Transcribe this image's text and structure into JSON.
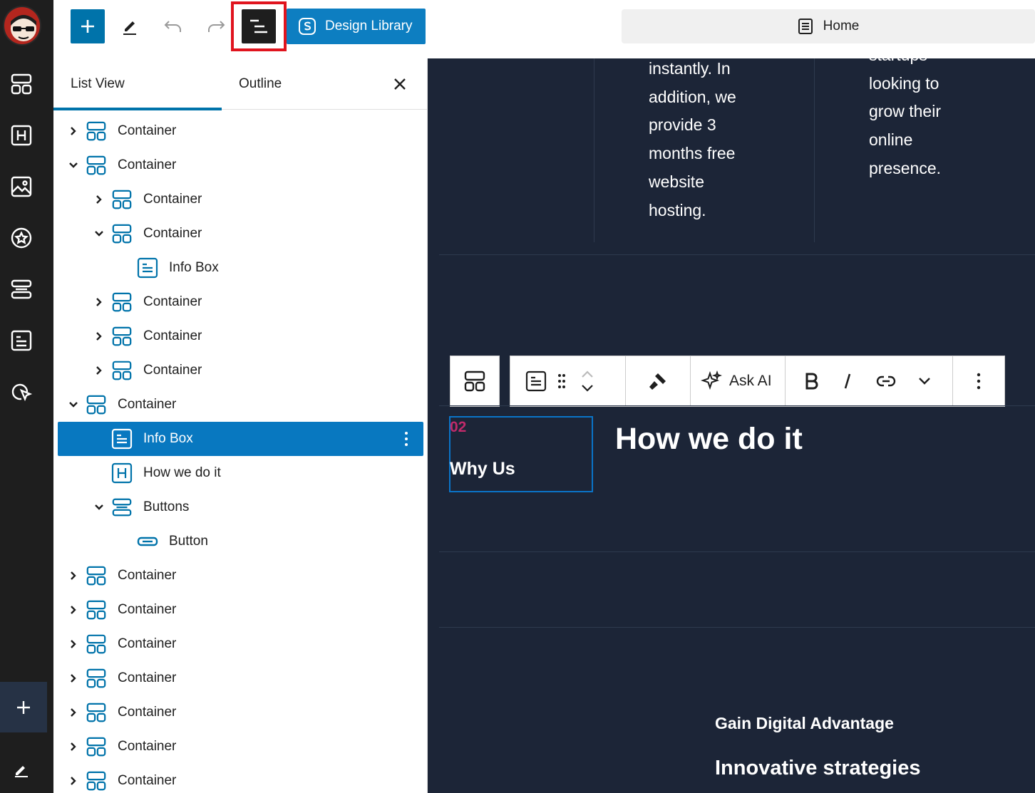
{
  "toolbar": {
    "design_library_label": "Design Library",
    "document_title": "Home"
  },
  "panel": {
    "tabs": [
      "List View",
      "Outline"
    ]
  },
  "tree": [
    {
      "label": "Container",
      "icon": "container-icon",
      "chevron": "right"
    },
    {
      "label": "Container",
      "icon": "container-icon",
      "chevron": "down"
    },
    {
      "label": "Container",
      "icon": "container-icon",
      "chevron": "right"
    },
    {
      "label": "Container",
      "icon": "container-icon",
      "chevron": "down"
    },
    {
      "label": "Info Box",
      "icon": "info-box-icon",
      "chevron": ""
    },
    {
      "label": "Container",
      "icon": "container-icon",
      "chevron": "right"
    },
    {
      "label": "Container",
      "icon": "container-icon",
      "chevron": "right"
    },
    {
      "label": "Container",
      "icon": "container-icon",
      "chevron": "right"
    },
    {
      "label": "Container",
      "icon": "container-icon",
      "chevron": "down"
    },
    {
      "label": "Info Box",
      "icon": "info-box-icon",
      "chevron": "",
      "selected": true
    },
    {
      "label": "How we do it",
      "icon": "heading-icon",
      "chevron": ""
    },
    {
      "label": "Buttons",
      "icon": "buttons-icon",
      "chevron": "down"
    },
    {
      "label": "Button",
      "icon": "button-icon",
      "chevron": ""
    },
    {
      "label": "Container",
      "icon": "container-icon",
      "chevron": "right"
    },
    {
      "label": "Container",
      "icon": "container-icon",
      "chevron": "right"
    },
    {
      "label": "Container",
      "icon": "container-icon",
      "chevron": "right"
    },
    {
      "label": "Container",
      "icon": "container-icon",
      "chevron": "right"
    },
    {
      "label": "Container",
      "icon": "container-icon",
      "chevron": "right"
    },
    {
      "label": "Container",
      "icon": "container-icon",
      "chevron": "right"
    },
    {
      "label": "Container",
      "icon": "container-icon",
      "chevron": "right"
    }
  ],
  "canvas": {
    "col1_lines": [
      "instantly. In",
      "addition, we",
      "provide 3",
      "months free",
      "website",
      "hosting."
    ],
    "col2_lines": [
      "startups",
      "looking to",
      "grow their",
      "online",
      "presence."
    ],
    "block_toolbar": {
      "ask_ai_label": "Ask AI"
    },
    "info_box_number": "02",
    "info_box_title": "Why Us",
    "heading": "How we do it",
    "gain_text": "Gain Digital Advantage",
    "innovative_text": "Innovative strategies"
  },
  "colors": {
    "accent": "#0073aa",
    "selected_row": "#0878c0",
    "canvas_bg": "#1c2537",
    "highlight_red": "#e0141e",
    "info_number": "#c02a6a"
  }
}
